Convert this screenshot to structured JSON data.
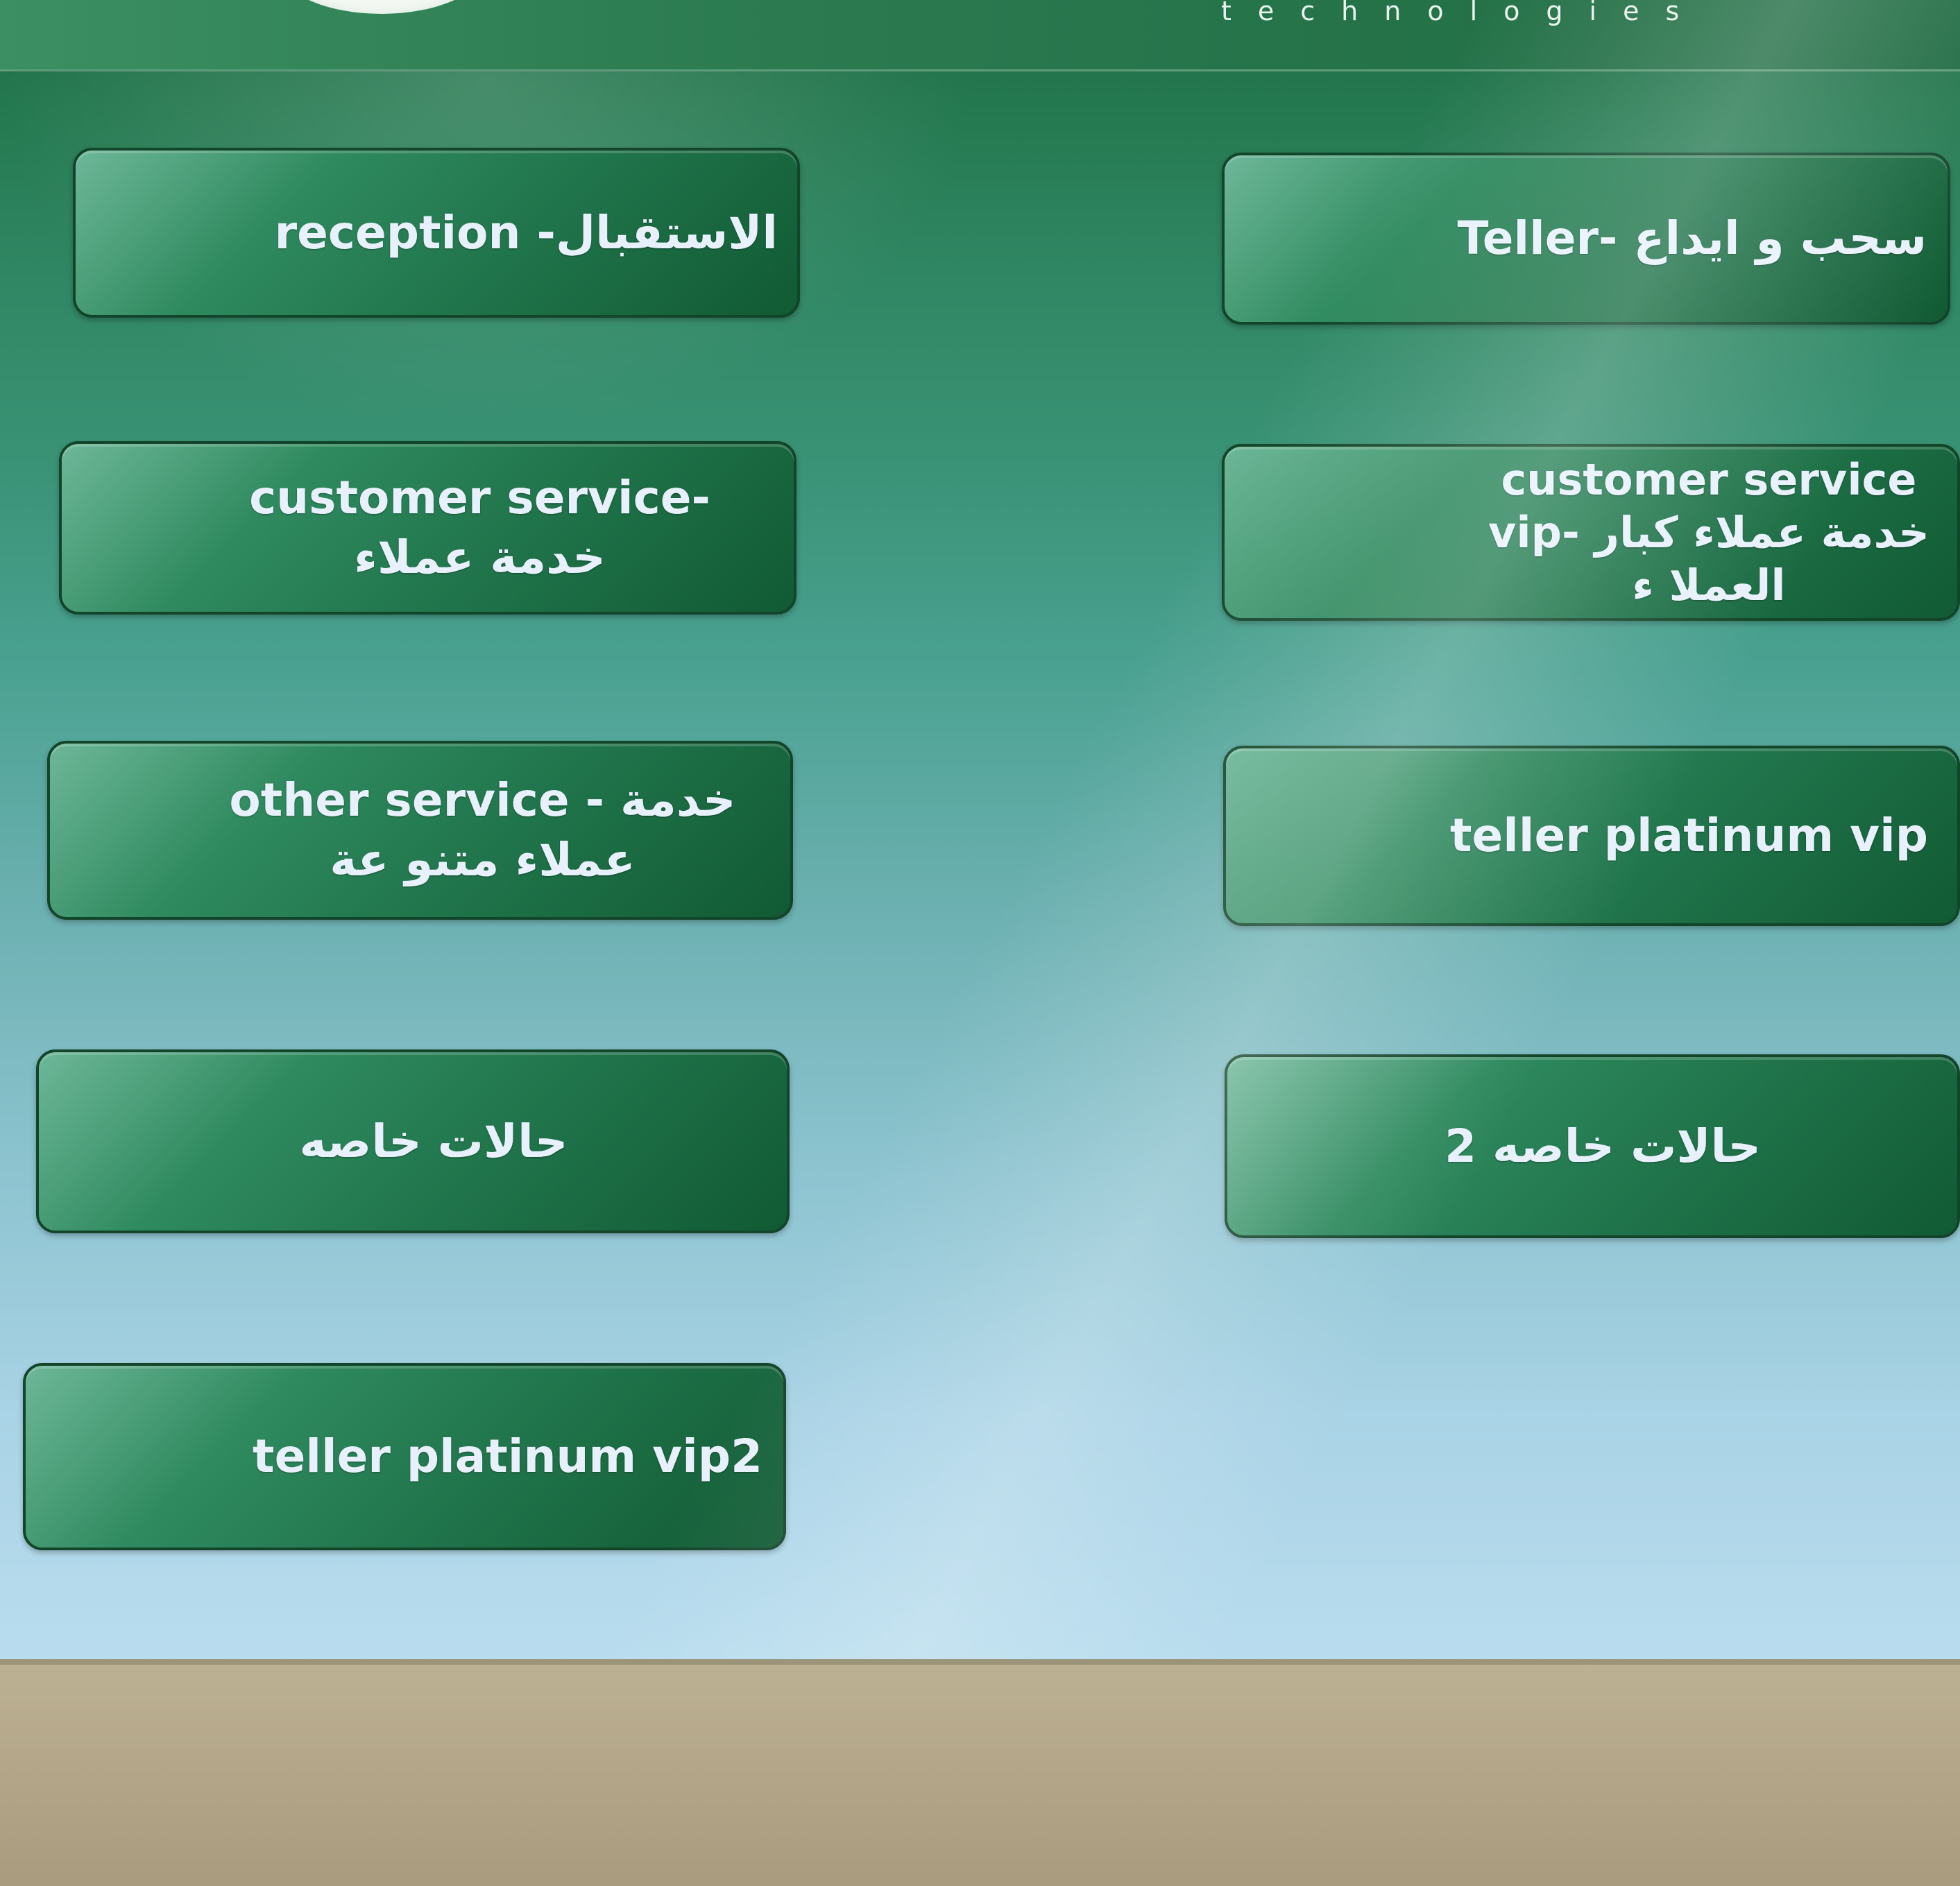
{
  "header": {
    "brand_text": "technologies"
  },
  "buttons": [
    {
      "id": "reception",
      "label": "reception -الاستقبال"
    },
    {
      "id": "teller",
      "label": "Teller- سحب و ايداع"
    },
    {
      "id": "customer_service",
      "label": "customer service-\nخدمة عملاء"
    },
    {
      "id": "customer_service_vip",
      "label": "customer service\nvip- خدمة عملاء كبار\nالعملا ء"
    },
    {
      "id": "other_service",
      "label": "other service - خدمة\nعملاء متنو عة"
    },
    {
      "id": "teller_platinum_vip",
      "label": "teller platinum vip"
    },
    {
      "id": "special_cases",
      "label": "حالات خاصه"
    },
    {
      "id": "special_cases_2",
      "label": "حالات خاصه 2"
    },
    {
      "id": "teller_platinum_vip2",
      "label": "teller platinum vip2"
    }
  ],
  "colors": {
    "button_fill": "#1e7148",
    "button_border": "#13452b",
    "button_text": "#e8f1fb",
    "screen_top": "#1c6b45",
    "screen_bottom": "#b9ddee"
  }
}
